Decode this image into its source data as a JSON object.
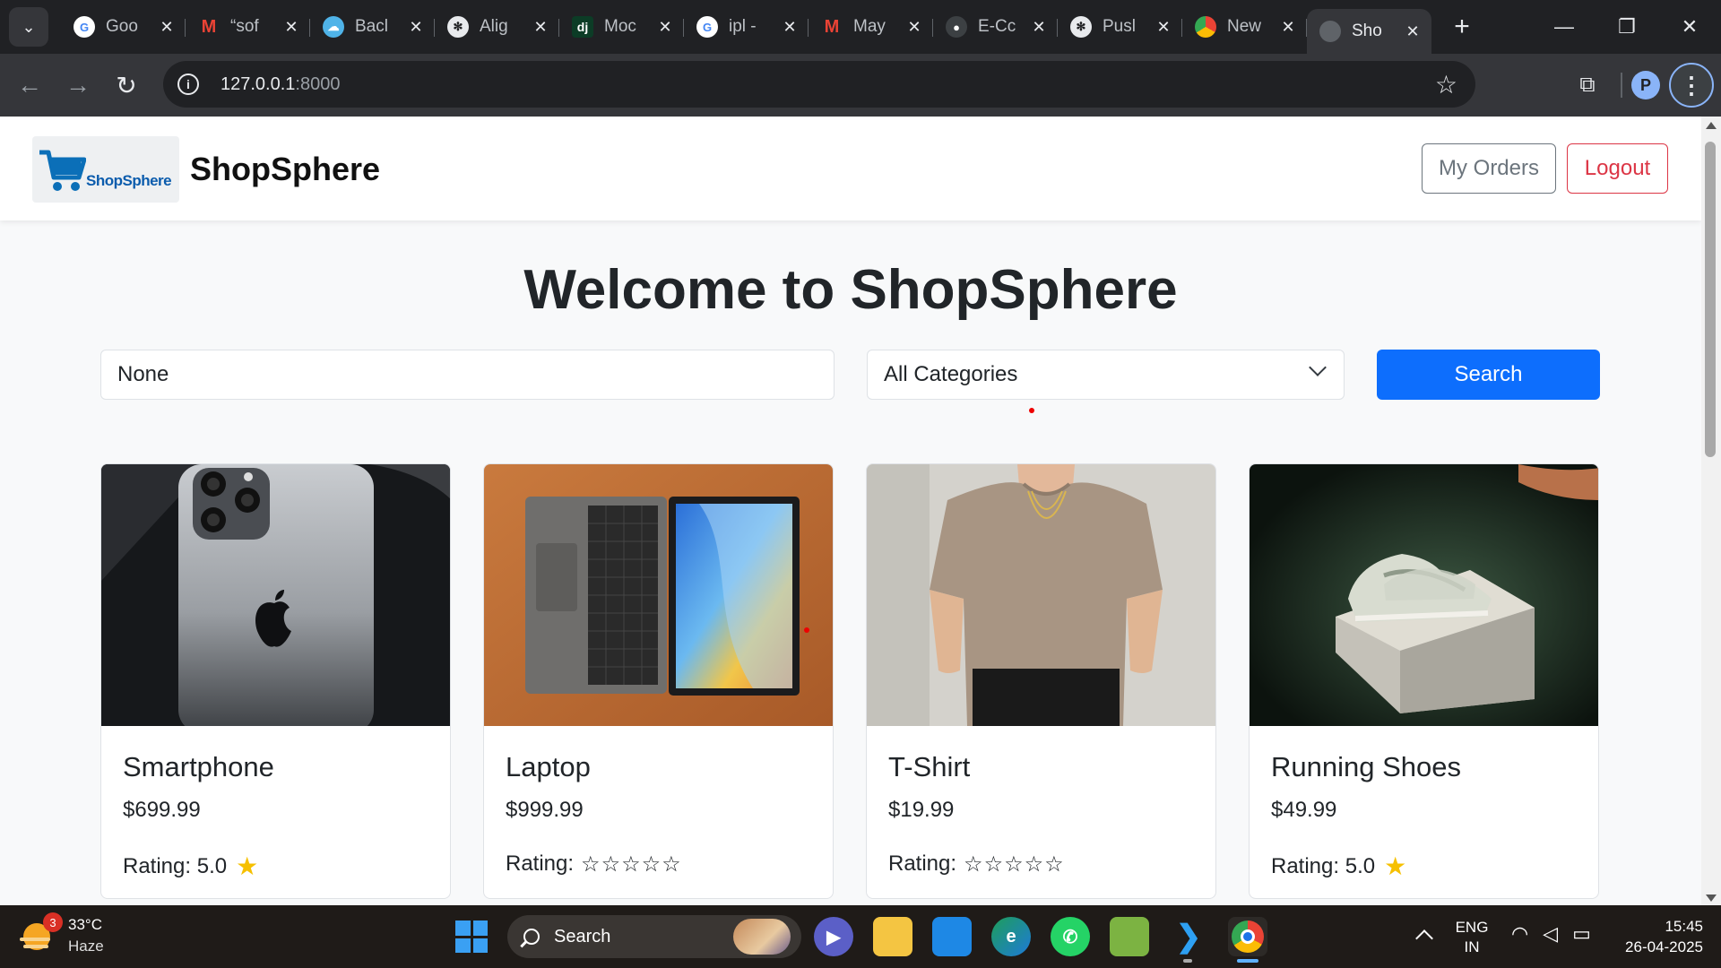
{
  "browser": {
    "tabs": [
      {
        "title": "Goo",
        "favicon": "google-icon"
      },
      {
        "title": "“sof",
        "favicon": "gmail-icon"
      },
      {
        "title": "Bacl",
        "favicon": "cloud-icon"
      },
      {
        "title": "Alig",
        "favicon": "openai-icon"
      },
      {
        "title": "Moc",
        "favicon": "django-icon"
      },
      {
        "title": "ipl -",
        "favicon": "google-icon"
      },
      {
        "title": "May",
        "favicon": "gmail-icon"
      },
      {
        "title": "E-Cc",
        "favicon": "github-icon"
      },
      {
        "title": "Pusl",
        "favicon": "openai-icon"
      },
      {
        "title": "New",
        "favicon": "chrome-icon"
      },
      {
        "title": "Sho",
        "favicon": "globe-icon",
        "active": true
      }
    ],
    "url_host": "127.0.0.1",
    "url_port": ":8000"
  },
  "site": {
    "logo_text": "ShopSphere",
    "brand": "ShopSphere",
    "nav": {
      "orders_label": "My Orders",
      "logout_label": "Logout"
    },
    "welcome_prefix": "Welcome to ",
    "welcome_brand": "ShopSphere",
    "search": {
      "value": "None",
      "category": "All Categories",
      "button_label": "Search"
    }
  },
  "products": [
    {
      "name": "Smartphone",
      "price": "$699.99",
      "rating_label": "Rating:",
      "rating_value": "5.0",
      "rating_display": "star",
      "image": "smartphone-photo"
    },
    {
      "name": "Laptop",
      "price": "$999.99",
      "rating_label": "Rating:",
      "rating_value": "",
      "rating_display": "empty-stars",
      "empty_stars": "☆☆☆☆☆",
      "image": "laptop-photo"
    },
    {
      "name": "T-Shirt",
      "price": "$19.99",
      "rating_label": "Rating:",
      "rating_value": "",
      "rating_display": "empty-stars",
      "empty_stars": "☆☆☆☆☆",
      "image": "tshirt-photo"
    },
    {
      "name": "Running Shoes",
      "price": "$49.99",
      "rating_label": "Rating:",
      "rating_value": "5.0",
      "rating_display": "star",
      "image": "shoes-photo"
    }
  ],
  "taskbar": {
    "weather_temp": "33°C",
    "weather_desc": "Haze",
    "weather_badge": "3",
    "search_label": "Search",
    "lang_line1": "ENG",
    "lang_line2": "IN",
    "time": "15:45",
    "date": "26-04-2025"
  },
  "colors": {
    "primary": "#0d6efd",
    "danger": "#dc3545",
    "secondary": "#6c757d",
    "star": "#f6c000"
  }
}
